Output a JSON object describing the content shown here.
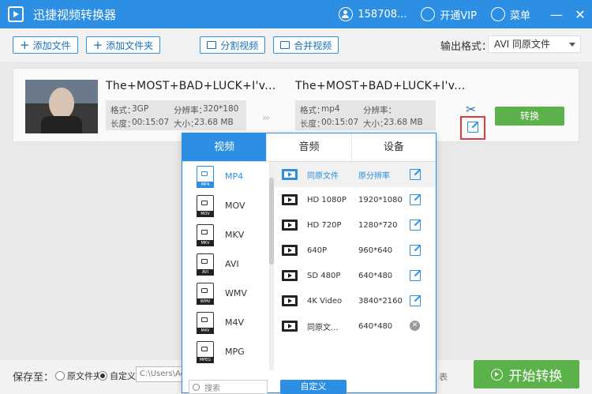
{
  "app": {
    "title": "迅捷视频转换器",
    "user": "158708...",
    "vip": "开通VIP",
    "menu": "菜单",
    "minimize": "—",
    "close": "✕"
  },
  "toolbar": {
    "add_file": "添加文件",
    "add_folder": "添加文件夹",
    "split": "分割视频",
    "merge": "合并视频",
    "output_format_label": "输出格式：",
    "output_format_value": "AVI  同原文件"
  },
  "file": {
    "source_name": "The+MOST+BAD+LUCK+I'v...",
    "source": {
      "format_label": "格式：",
      "format": "3GP",
      "res_label": "分辨率：",
      "resolution": "320*180",
      "length_label": "长度：",
      "length": "00:15:07",
      "size_label": "大小：",
      "size": "23.68 MB"
    },
    "target_name": "The+MOST+BAD+LUCK+I'v...",
    "target": {
      "format_label": "格式：",
      "format": "mp4",
      "res_label": "分辨率：",
      "resolution": "",
      "length_label": "长度：",
      "length": "00:15:07",
      "size_label": "大小：",
      "size": "23.68 MB"
    },
    "arrows": "›››",
    "convert": "转换"
  },
  "popup": {
    "tabs": [
      "视频",
      "音频",
      "设备"
    ],
    "formats": [
      {
        "name": "MP4",
        "tag": "MP4"
      },
      {
        "name": "MOV",
        "tag": "MOV"
      },
      {
        "name": "MKV",
        "tag": "MKV"
      },
      {
        "name": "AVI",
        "tag": "AVI"
      },
      {
        "name": "WMV",
        "tag": "WMV"
      },
      {
        "name": "M4V",
        "tag": "M4V"
      },
      {
        "name": "MPG",
        "tag": "MPEG"
      }
    ],
    "resolutions": [
      {
        "name": "同原文件",
        "value": "原分辨率"
      },
      {
        "name": "HD 1080P",
        "value": "1920*1080"
      },
      {
        "name": "HD 720P",
        "value": "1280*720"
      },
      {
        "name": "640P",
        "value": "960*640"
      },
      {
        "name": "SD 480P",
        "value": "640*480"
      },
      {
        "name": "4K Video",
        "value": "3840*2160"
      },
      {
        "name": "同原文...",
        "value": "640*480"
      }
    ],
    "search_placeholder": "搜索",
    "custom": "自定义"
  },
  "bottom": {
    "save_to": "保存至：",
    "opt_original": "原文件夹",
    "opt_custom": "自定义",
    "path": "C:\\Users\\Ad",
    "list_hint": "表",
    "start": "开始转换"
  }
}
